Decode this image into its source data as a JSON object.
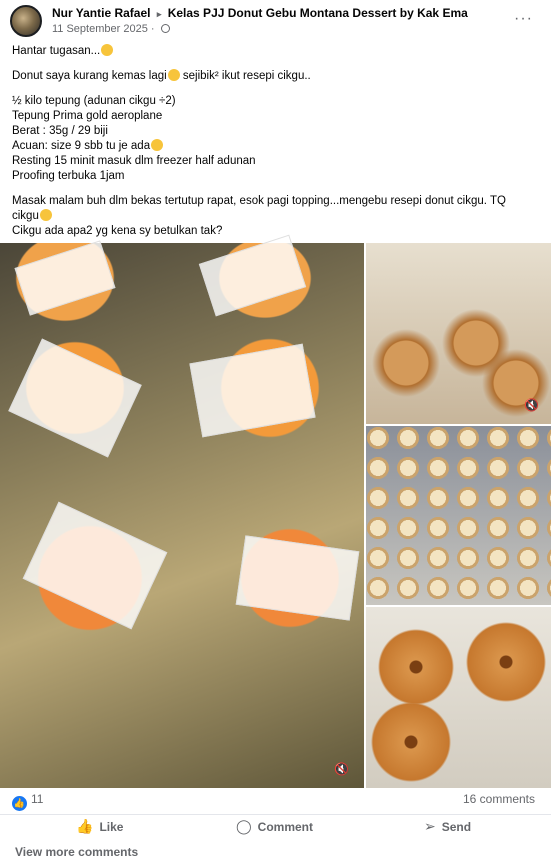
{
  "post": {
    "author": "Nur Yantie Rafael",
    "separator": "▸",
    "group": "Kelas PJJ Donut Gebu Montana Dessert by Kak Ema",
    "date": "11 September 2025",
    "more_icon": "···",
    "text_lines": [
      "Hantar tugasan...",
      "Donut saya kurang kemas lagi",
      "sejibik² ikut resepi cikgu..",
      "½ kilo tepung (adunan cikgu ÷2)",
      "Tepung Prima gold aeroplane",
      "Berat : 35g / 29 biji",
      "Acuan: size 9 sbb tu je ada",
      "Resting 15 minit masuk dlm freezer half adunan",
      "Proofing terbuka 1jam",
      "Masak malam buh dlm bekas tertutup rapat, esok pagi topping...mengebu resepi donut cikgu. TQ",
      "cikgu",
      "Cikgu ada apa2 yg kena sy betulkan tak?"
    ]
  },
  "media": {
    "mute_icon": "🔇"
  },
  "footer": {
    "like_count": "11",
    "comments_count": "16 comments",
    "like_label": "Like",
    "comment_label": "Comment",
    "send_label": "Send",
    "view_more": "View more comments"
  },
  "colors": {
    "accent": "#1877f2",
    "muted": "#65676b"
  }
}
